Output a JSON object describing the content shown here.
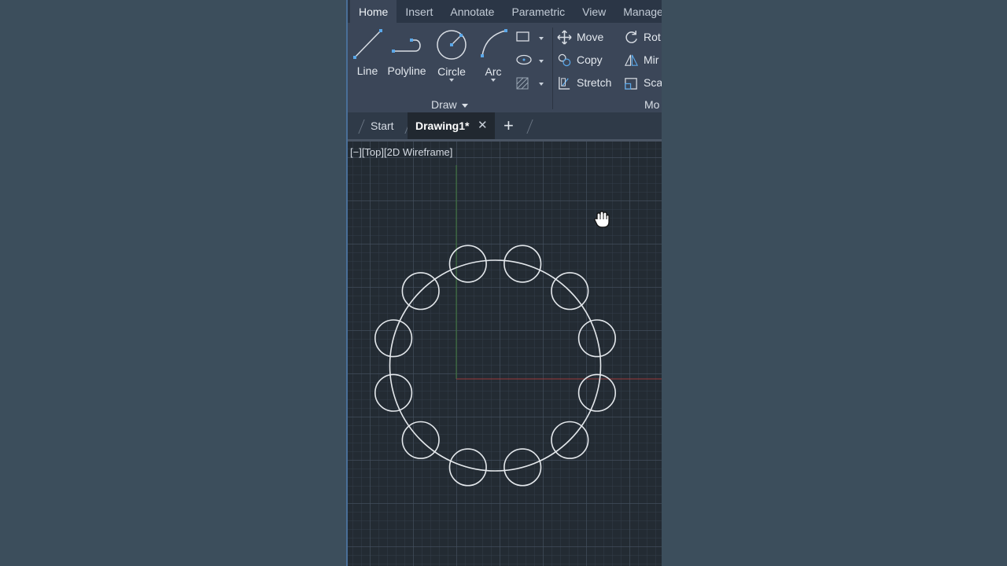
{
  "ribbon_tabs": [
    {
      "label": "Home",
      "active": true
    },
    {
      "label": "Insert",
      "active": false
    },
    {
      "label": "Annotate",
      "active": false
    },
    {
      "label": "Parametric",
      "active": false
    },
    {
      "label": "View",
      "active": false
    },
    {
      "label": "Manage",
      "active": false
    }
  ],
  "draw_panel": {
    "title": "Draw",
    "tools": {
      "line": "Line",
      "polyline": "Polyline",
      "circle": "Circle",
      "arc": "Arc"
    },
    "small_tools": [
      "rectangle-icon",
      "ellipse-icon",
      "hatch-icon"
    ]
  },
  "modify_panel": {
    "title": "Mo",
    "tools": {
      "move": "Move",
      "copy": "Copy",
      "stretch": "Stretch",
      "rotate": "Rot",
      "mirror": "Mir",
      "scale": "Sca"
    }
  },
  "file_tabs": {
    "start": "Start",
    "active": "Drawing1*",
    "new_tab_icon": "plus-icon",
    "close_icon": "close-icon"
  },
  "viewport": {
    "label": "[−][Top][2D Wireframe]",
    "cursor_icon": "pan-hand-icon"
  },
  "drawing": {
    "main_circle_radius": 1,
    "small_circle_count": 12,
    "small_circle_radius_ratio": 0.174,
    "line_color": "#e4e8ec"
  },
  "colors": {
    "x_axis": "#9a3a3a",
    "y_axis": "#3f7a3a"
  }
}
